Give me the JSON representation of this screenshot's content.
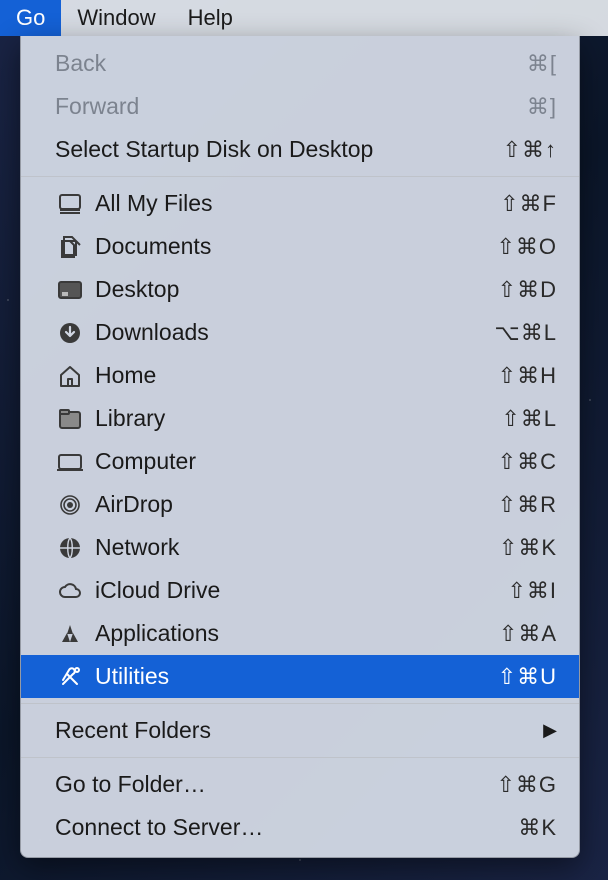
{
  "menubar": {
    "go": "Go",
    "window": "Window",
    "help": "Help"
  },
  "menu": {
    "back": {
      "label": "Back",
      "shortcut": "⌘["
    },
    "forward": {
      "label": "Forward",
      "shortcut": "⌘]"
    },
    "selectStartup": {
      "label": "Select Startup Disk on Desktop",
      "shortcut": "⇧⌘↑"
    },
    "allMyFiles": {
      "label": "All My Files",
      "shortcut": "⇧⌘F"
    },
    "documents": {
      "label": "Documents",
      "shortcut": "⇧⌘O"
    },
    "desktop": {
      "label": "Desktop",
      "shortcut": "⇧⌘D"
    },
    "downloads": {
      "label": "Downloads",
      "shortcut": "⌥⌘L"
    },
    "home": {
      "label": "Home",
      "shortcut": "⇧⌘H"
    },
    "library": {
      "label": "Library",
      "shortcut": "⇧⌘L"
    },
    "computer": {
      "label": "Computer",
      "shortcut": "⇧⌘C"
    },
    "airdrop": {
      "label": "AirDrop",
      "shortcut": "⇧⌘R"
    },
    "network": {
      "label": "Network",
      "shortcut": "⇧⌘K"
    },
    "icloud": {
      "label": "iCloud Drive",
      "shortcut": "⇧⌘I"
    },
    "applications": {
      "label": "Applications",
      "shortcut": "⇧⌘A"
    },
    "utilities": {
      "label": "Utilities",
      "shortcut": "⇧⌘U"
    },
    "recentFolders": {
      "label": "Recent Folders"
    },
    "goToFolder": {
      "label": "Go to Folder…",
      "shortcut": "⇧⌘G"
    },
    "connectToServer": {
      "label": "Connect to Server…",
      "shortcut": "⌘K"
    }
  }
}
